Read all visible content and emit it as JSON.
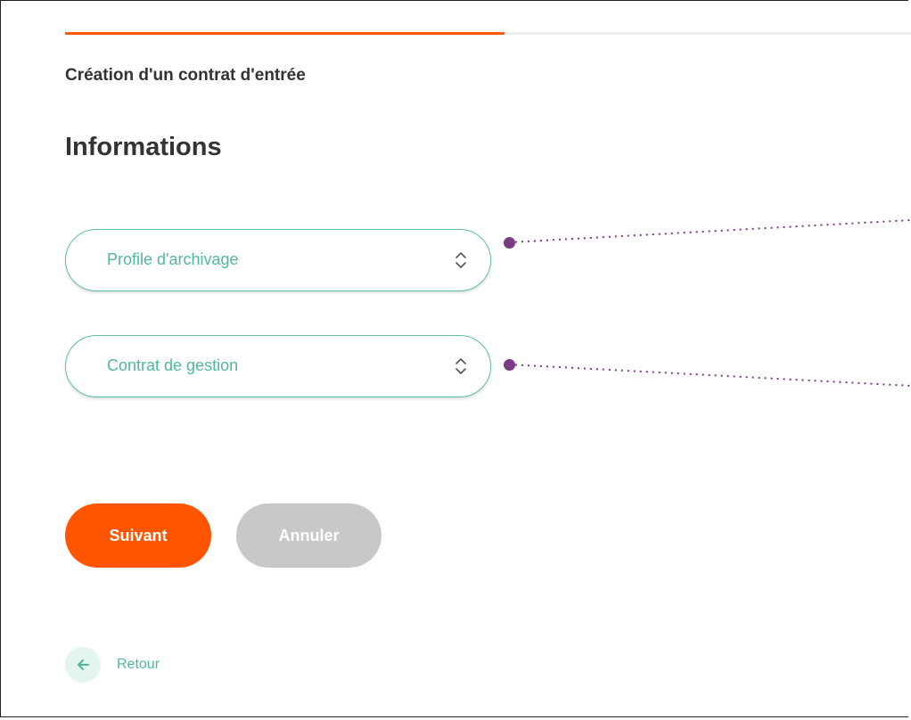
{
  "header": {
    "subtitle": "Création d'un contrat d'entrée",
    "title": "Informations",
    "progress_fraction": 0.52
  },
  "form": {
    "profile_select": {
      "placeholder": "Profile d'archivage"
    },
    "contract_select": {
      "placeholder": "Contrat de gestion"
    }
  },
  "actions": {
    "next_label": "Suivant",
    "cancel_label": "Annuler",
    "back_label": "Retour"
  },
  "icons": {
    "select_chevron": "chevron-up-down-icon",
    "back_arrow": "arrow-left-icon"
  },
  "colors": {
    "accent": "#ff5500",
    "teal": "#4fb89b",
    "annotation": "#7b3b84",
    "disabled": "#c8c8c8"
  }
}
